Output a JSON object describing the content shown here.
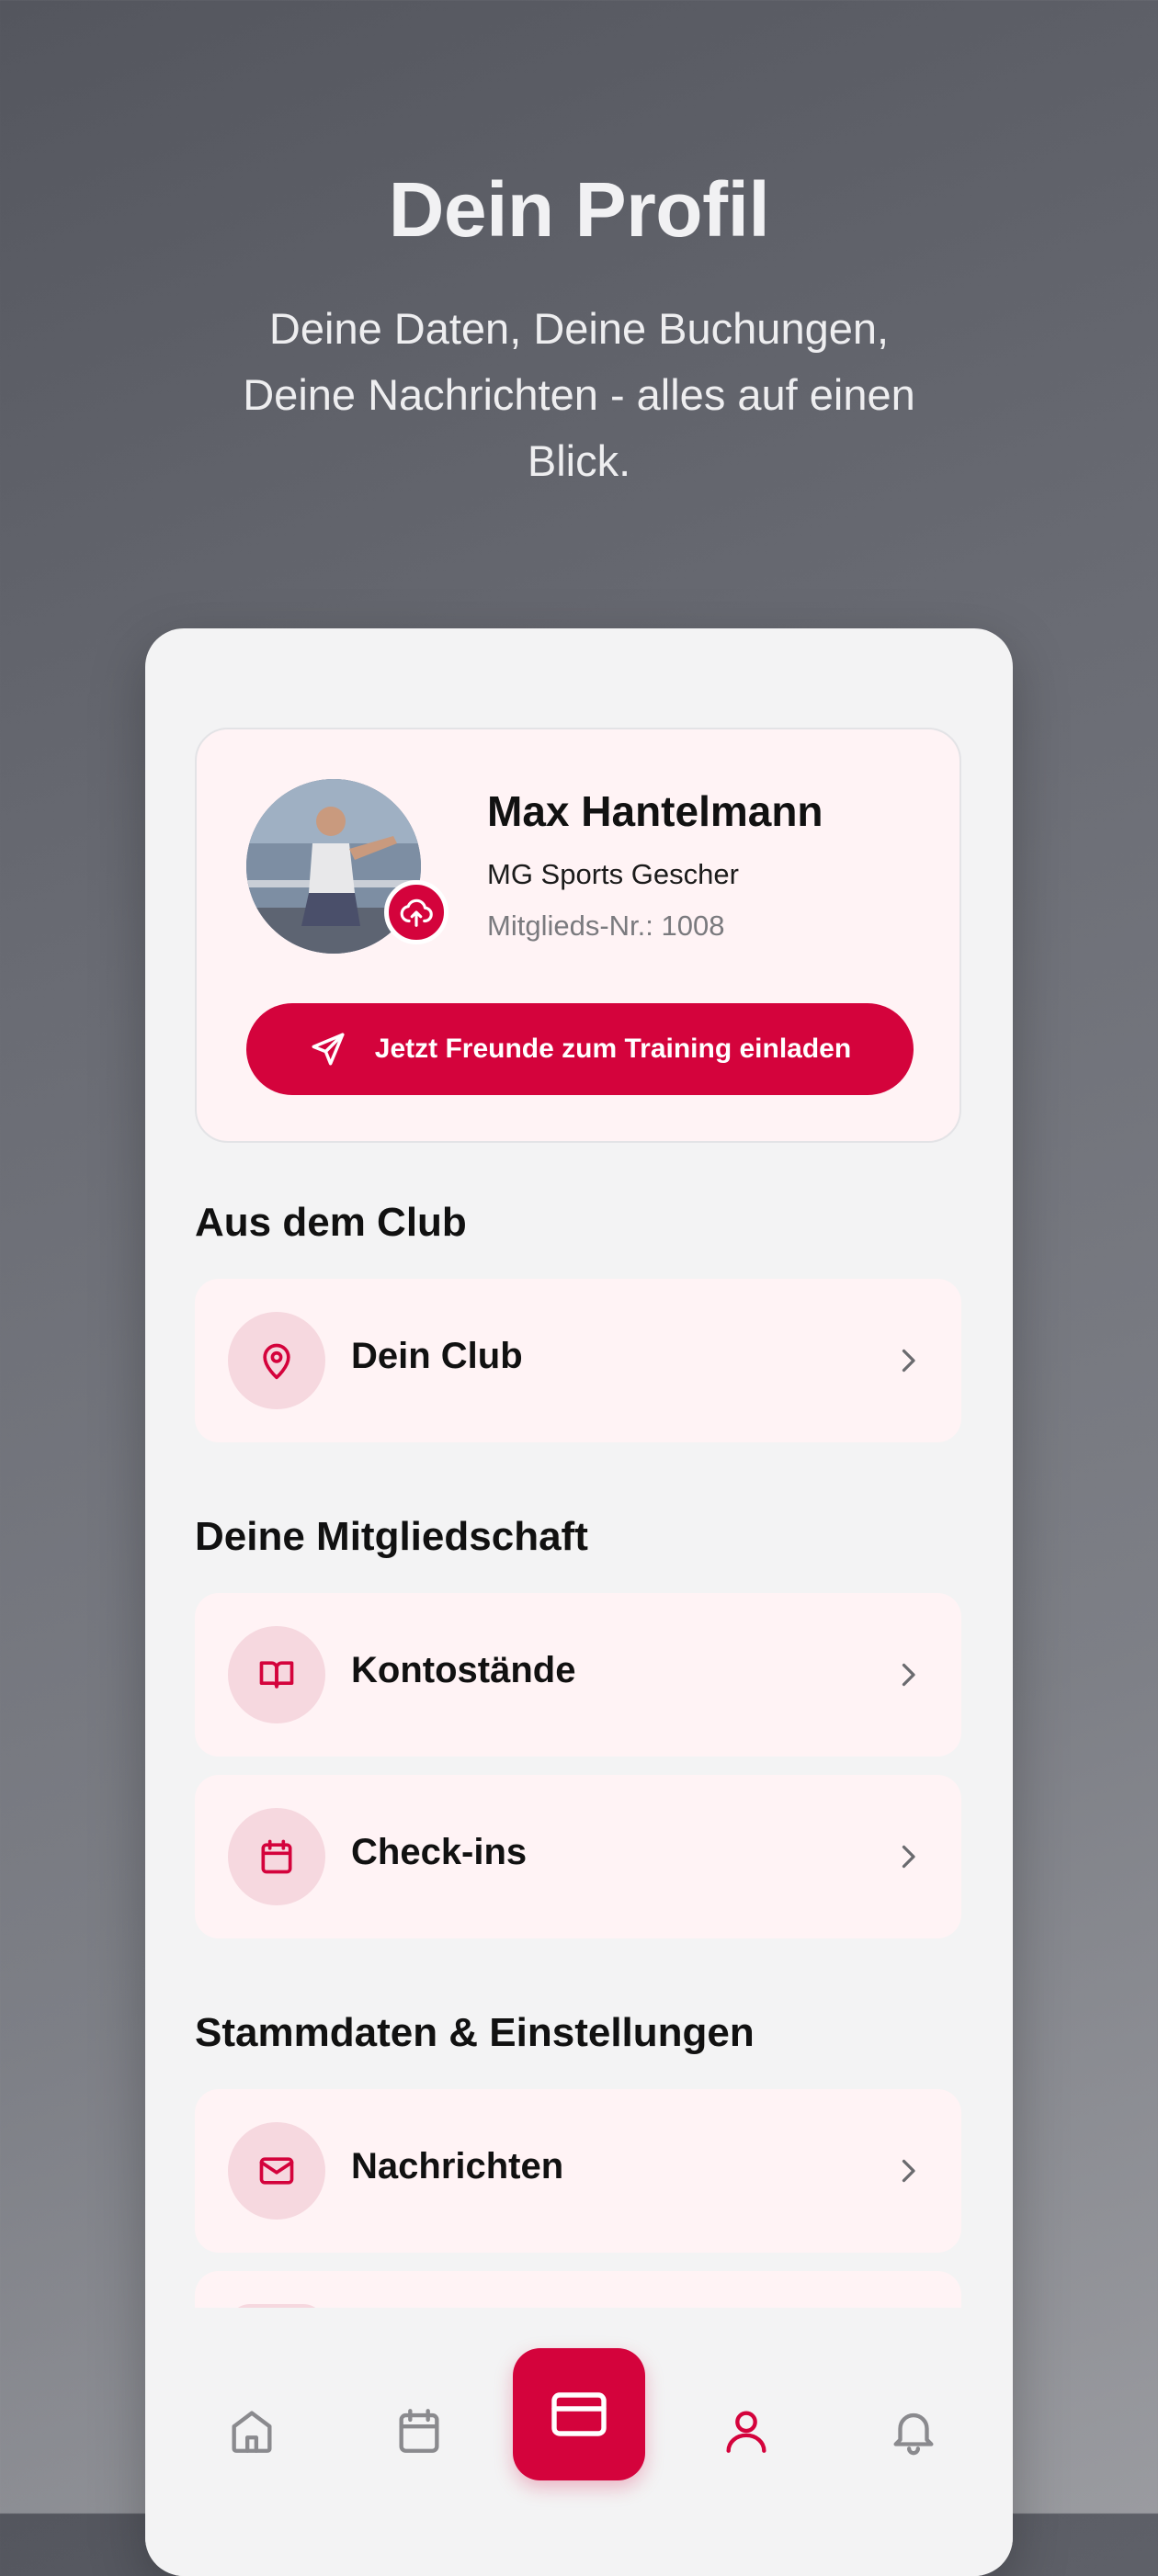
{
  "hero": {
    "title": "Dein Profil",
    "subtitle": "Deine Daten, Deine Buchungen, Deine Nachrichten - alles auf einen Blick."
  },
  "profile": {
    "name": "Max Hantelmann",
    "club": "MG Sports Gescher",
    "member_number": "Mitglieds-Nr.: 1008",
    "invite_button": "Jetzt Freunde zum Training einladen"
  },
  "sections": {
    "club": {
      "title": "Aus dem Club",
      "items": [
        {
          "label": "Dein Club",
          "icon": "location-pin-icon"
        }
      ]
    },
    "membership": {
      "title": "Deine Mitgliedschaft",
      "items": [
        {
          "label": "Kontostände",
          "icon": "book-icon"
        },
        {
          "label": "Check-ins",
          "icon": "calendar-icon"
        }
      ]
    },
    "settings": {
      "title": "Stammdaten & Einstellungen",
      "items": [
        {
          "label": "Nachrichten",
          "icon": "mail-icon"
        }
      ]
    }
  },
  "tabbar": {
    "items": [
      "home-icon",
      "calendar-icon",
      "card-icon",
      "user-icon",
      "bell-icon"
    ],
    "active": "user-icon"
  },
  "colors": {
    "accent": "#d4033c",
    "card_bg": "#fff3f5",
    "icon_bg": "#f6d8df",
    "inactive_icon": "#8a8a8e"
  }
}
